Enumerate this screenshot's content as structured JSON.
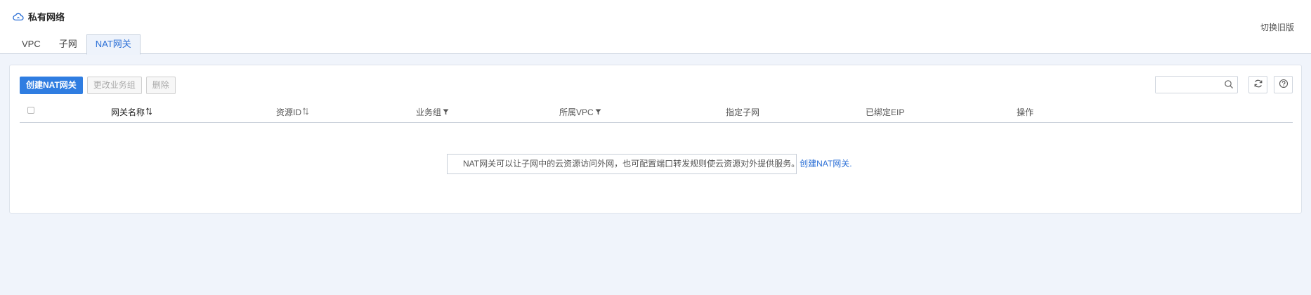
{
  "header": {
    "title": "私有网络",
    "title_icon": "cloud-icon",
    "switch_old_label": "切换旧版"
  },
  "tabs": [
    {
      "label": "VPC",
      "active": false
    },
    {
      "label": "子网",
      "active": false
    },
    {
      "label": "NAT网关",
      "active": true
    }
  ],
  "toolbar": {
    "create_label": "创建NAT网关",
    "change_group_label": "更改业务组",
    "delete_label": "删除"
  },
  "search": {
    "placeholder": "",
    "value": ""
  },
  "icons": {
    "search": "search-icon",
    "refresh": "refresh-icon",
    "help": "help-icon"
  },
  "table": {
    "columns": [
      {
        "label": "网关名称",
        "icon": "sort-icon"
      },
      {
        "label": "资源ID",
        "icon": "sort-icon"
      },
      {
        "label": "业务组",
        "icon": "filter-icon"
      },
      {
        "label": "所属VPC",
        "icon": "filter-icon"
      },
      {
        "label": "指定子网",
        "icon": ""
      },
      {
        "label": "已绑定EIP",
        "icon": ""
      },
      {
        "label": "操作",
        "icon": ""
      }
    ],
    "rows": []
  },
  "empty": {
    "message": "NAT网关可以让子网中的云资源访问外网，也可配置端口转发规则使云资源对外提供服务。",
    "link_label": "创建NAT网关."
  },
  "colors": {
    "accent": "#2f7de1",
    "link": "#2b6fd6",
    "background": "#f0f4fb"
  }
}
